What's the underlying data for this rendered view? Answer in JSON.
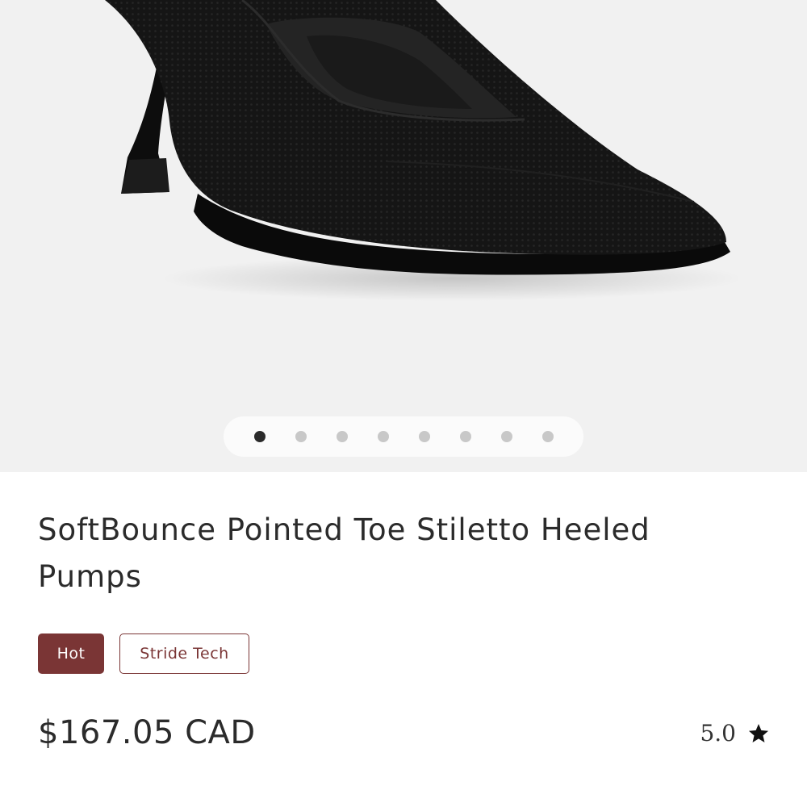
{
  "gallery": {
    "slide_count": 8,
    "active_index": 0
  },
  "product": {
    "title": "SoftBounce Pointed Toe Stiletto Heeled Pumps",
    "badges": {
      "hot": "Hot",
      "tech": "Stride Tech"
    },
    "price": "$167.05 CAD",
    "rating": "5.0"
  },
  "colors": {
    "accent": "#7a3535",
    "gallery_bg": "#f1f1f1",
    "text": "#2b2b2b"
  },
  "icons": {
    "rating": "star-icon"
  }
}
